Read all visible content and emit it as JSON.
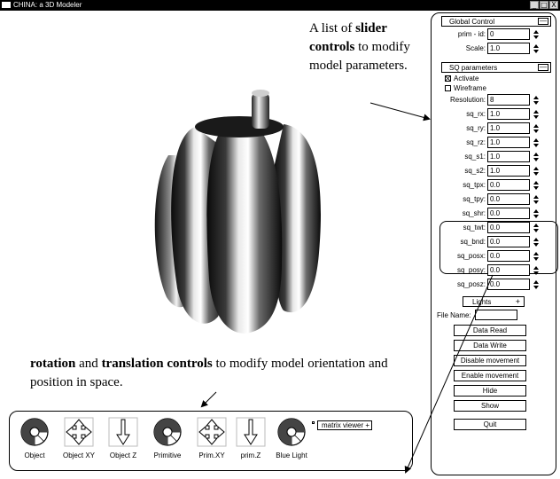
{
  "window": {
    "title": "CHINA: a 3D Modeler",
    "buttons": [
      "_",
      "□",
      "X"
    ]
  },
  "annotations": {
    "top": {
      "p1": "A list of ",
      "b1": "slider controls",
      "p2": " to modify model parameters."
    },
    "bottom": {
      "b1": "rotation",
      "p1": " and ",
      "b2": "translation controls",
      "p2": " to modify model orientation and position in space."
    }
  },
  "global_control": {
    "header": "Global Control",
    "toggle": "—",
    "fields": [
      {
        "label": "prim - id:",
        "value": "0"
      },
      {
        "label": "Scale:",
        "value": "1.0"
      }
    ]
  },
  "sq_parameters": {
    "header": "SQ parameters",
    "toggle": "—",
    "checkboxes": [
      {
        "label": "Activate",
        "checked": true
      },
      {
        "label": "Wireframe",
        "checked": false
      }
    ],
    "fields": [
      {
        "label": "Resolution:",
        "value": "8"
      },
      {
        "label": "sq_rx:",
        "value": "1.0"
      },
      {
        "label": "sq_ry:",
        "value": "1.0"
      },
      {
        "label": "sq_rz:",
        "value": "1.0"
      },
      {
        "label": "sq_s1:",
        "value": "1.0"
      },
      {
        "label": "sq_s2:",
        "value": "1.0"
      },
      {
        "label": "sq_tpx:",
        "value": "0.0"
      },
      {
        "label": "sq_tpy:",
        "value": "0.0"
      },
      {
        "label": "sq_shr:",
        "value": "0.0"
      },
      {
        "label": "sq_twt:",
        "value": "0.0"
      },
      {
        "label": "sq_bnd:",
        "value": "0.0"
      },
      {
        "label": "sq_posx:",
        "value": "0.0"
      },
      {
        "label": "sq_posy:",
        "value": "0.0"
      },
      {
        "label": "sq_posz:",
        "value": "0.0"
      }
    ]
  },
  "lights": {
    "header": "Lights",
    "toggle": "+",
    "file_name_label": "File Name:",
    "file_name_value": ""
  },
  "actions": [
    "Data Read",
    "Data Write",
    "Disable movement",
    "Enable movement",
    "Hide",
    "Show"
  ],
  "quit_label": "Quit",
  "toolbar": {
    "tools": [
      {
        "label": "Object",
        "icon": "rotate-ball-icon"
      },
      {
        "label": "Object XY",
        "icon": "move-xy-icon"
      },
      {
        "label": "Object Z",
        "icon": "move-z-icon"
      },
      {
        "label": "Primitive",
        "icon": "rotate-ball-icon"
      },
      {
        "label": "Prim.XY",
        "icon": "move-xy-icon"
      },
      {
        "label": "prim.Z",
        "icon": "move-z-icon"
      },
      {
        "label": "Blue Light",
        "icon": "rotate-ball-icon"
      }
    ],
    "matrix_viewer": {
      "label": "matrix viewer",
      "toggle": "+"
    }
  }
}
